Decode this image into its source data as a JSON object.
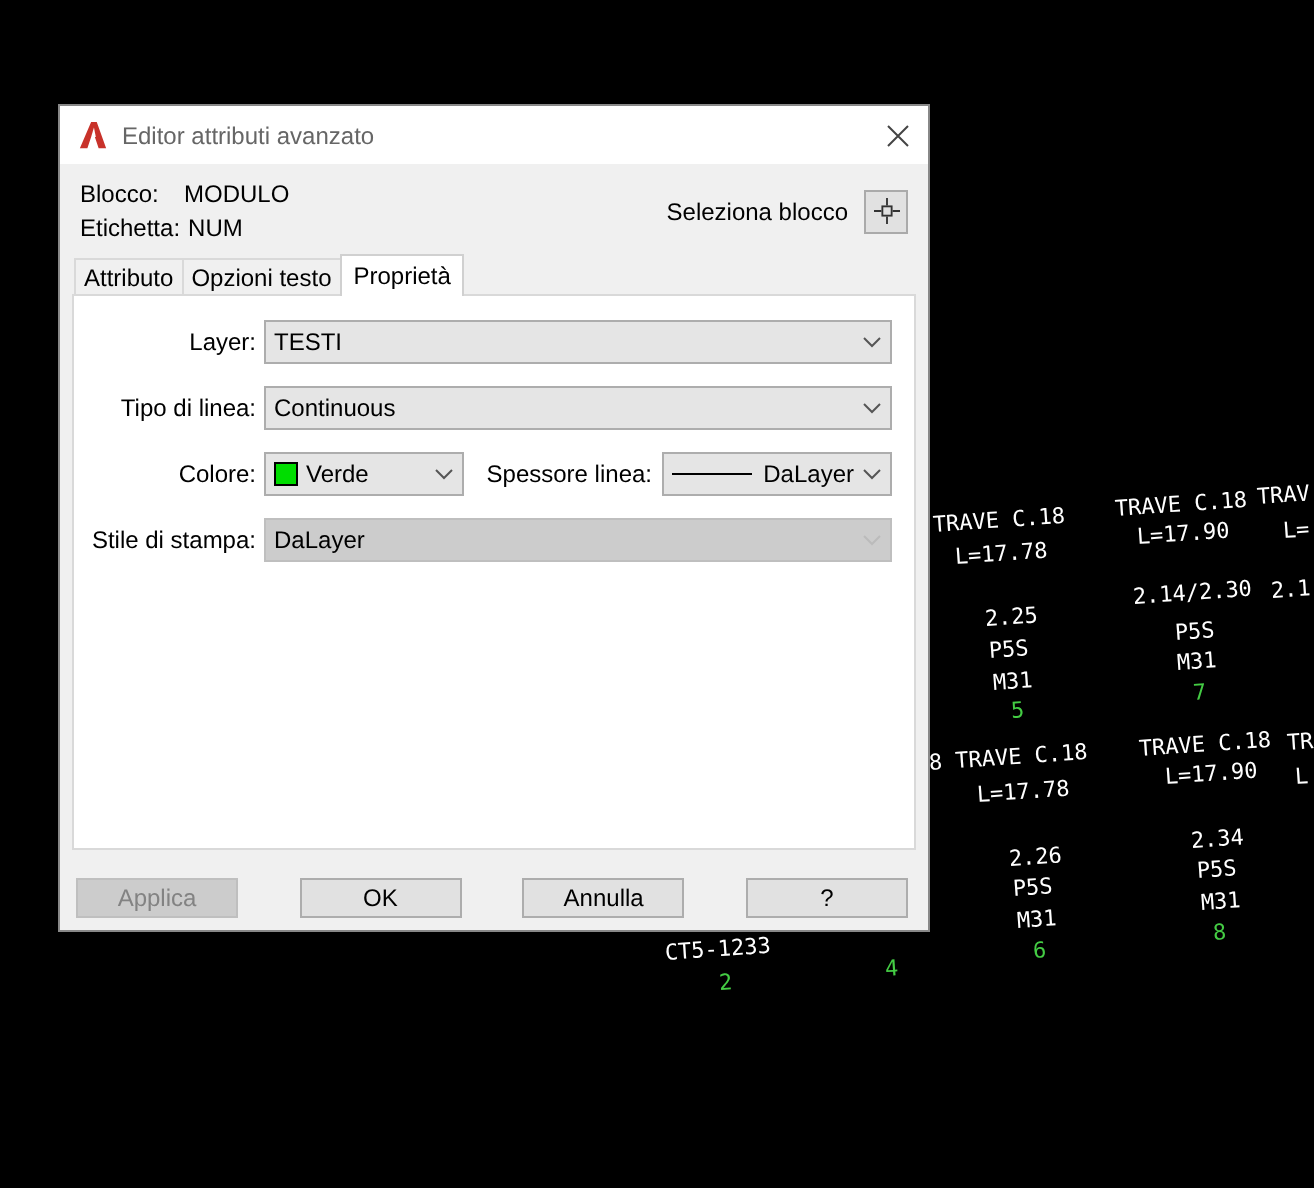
{
  "window": {
    "title": "Editor attributi avanzato"
  },
  "block": {
    "label": "Blocco:",
    "value": "MODULO"
  },
  "tag": {
    "label": "Etichetta:",
    "value": "NUM"
  },
  "select_block": {
    "label": "Seleziona blocco"
  },
  "tabs": [
    {
      "label": "Attributo",
      "selected": false
    },
    {
      "label": "Opzioni testo",
      "selected": false
    },
    {
      "label": "Proprietà",
      "selected": true
    }
  ],
  "layer": {
    "label": "Layer:",
    "value": "TESTI",
    "disabled": false
  },
  "linetype": {
    "label": "Tipo di linea:",
    "value": "Continuous",
    "disabled": false
  },
  "color": {
    "label": "Colore:",
    "value": "Verde",
    "color": "#00dd00"
  },
  "lineweight": {
    "label": "Spessore linea:",
    "value": "DaLayer"
  },
  "plot_style": {
    "label": "Stile di stampa:",
    "value": "DaLayer",
    "disabled": true
  },
  "buttons": [
    {
      "label": "Applica",
      "disabled": true
    },
    {
      "label": "OK",
      "disabled": false
    },
    {
      "label": "Annulla",
      "disabled": false
    },
    {
      "label": "?",
      "disabled": false
    }
  ],
  "cad_labels": [
    {
      "text": "TRAVE C.18",
      "color": "#ffffff"
    },
    {
      "text": "L=17.78",
      "color": "#ffffff"
    },
    {
      "text": "2.25",
      "color": "#ffffff"
    },
    {
      "text": "P5S",
      "color": "#ffffff"
    },
    {
      "text": "M31",
      "color": "#ffffff"
    },
    {
      "text": "5",
      "color": "#44cc44"
    },
    {
      "text": "TRAVE C.18",
      "color": "#ffffff"
    },
    {
      "text": "L=17.90",
      "color": "#ffffff"
    },
    {
      "text": "TRAV",
      "color": "#ffffff"
    },
    {
      "text": "L=",
      "color": "#ffffff"
    },
    {
      "text": "2.14/2.30",
      "color": "#ffffff"
    },
    {
      "text": "2.1",
      "color": "#ffffff"
    },
    {
      "text": "P5S",
      "color": "#ffffff"
    },
    {
      "text": "M31",
      "color": "#ffffff"
    },
    {
      "text": "7",
      "color": "#44cc44"
    },
    {
      "text": "8 TRAVE C.18",
      "color": "#ffffff"
    },
    {
      "text": "L=17.78",
      "color": "#ffffff"
    },
    {
      "text": "TRAVE C.18",
      "color": "#ffffff"
    },
    {
      "text": "L=17.90",
      "color": "#ffffff"
    },
    {
      "text": "TR",
      "color": "#ffffff"
    },
    {
      "text": "L",
      "color": "#ffffff"
    },
    {
      "text": "2.26",
      "color": "#ffffff"
    },
    {
      "text": "P5S",
      "color": "#ffffff"
    },
    {
      "text": "M31",
      "color": "#ffffff"
    },
    {
      "text": "6",
      "color": "#44cc44"
    },
    {
      "text": "2.34",
      "color": "#ffffff"
    },
    {
      "text": "P5S",
      "color": "#ffffff"
    },
    {
      "text": "M31",
      "color": "#ffffff"
    },
    {
      "text": "8",
      "color": "#44cc44"
    },
    {
      "text": "CT5-1233",
      "color": "#ffffff"
    },
    {
      "text": "2",
      "color": "#44cc44"
    },
    {
      "text": "4",
      "color": "#44cc44"
    }
  ]
}
